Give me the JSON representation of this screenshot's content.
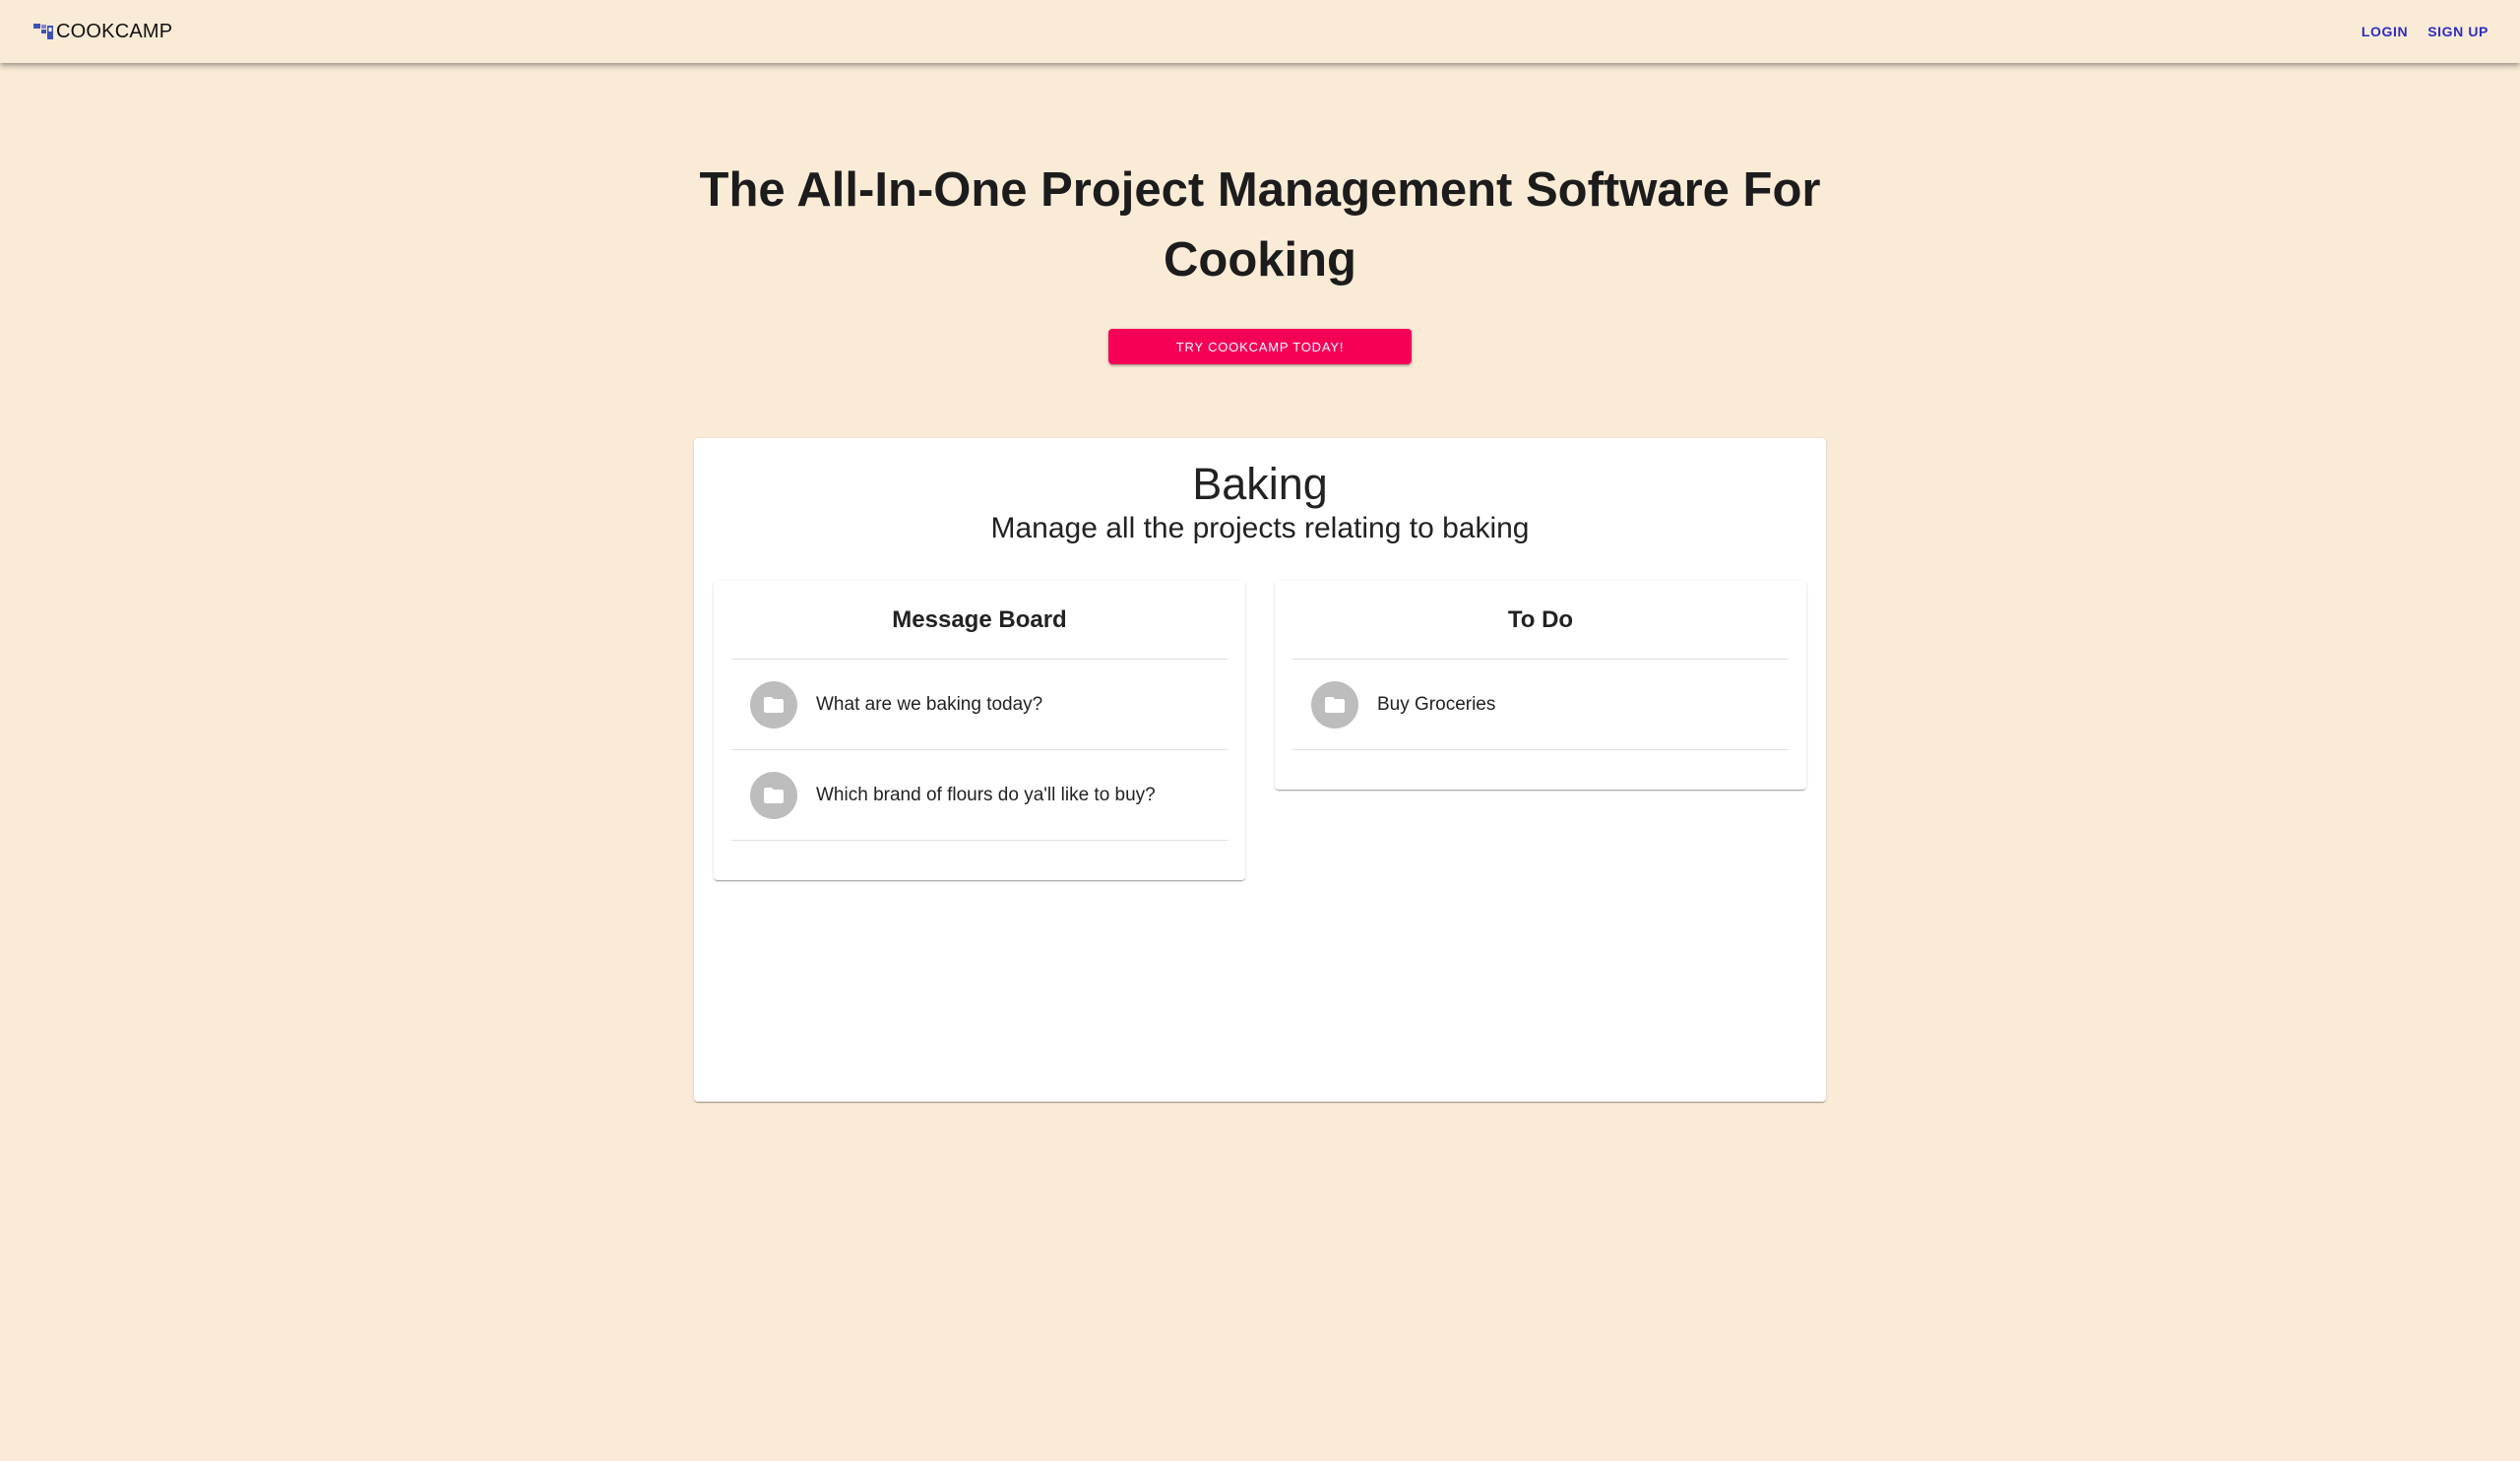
{
  "header": {
    "brand": "COOKCAMP",
    "brand_icon": "logo-grid-icon",
    "nav": {
      "login": "LOGIN",
      "signup": "SIGN UP"
    }
  },
  "hero": {
    "title": "The All-In-One Project Management Software For Cooking",
    "cta": "TRY COOKCAMP TODAY!"
  },
  "project": {
    "title": "Baking",
    "subtitle": "Manage all the projects relating to baking",
    "message_board": {
      "title": "Message Board",
      "items": [
        {
          "icon": "folder-icon",
          "label": "What are we baking today?"
        },
        {
          "icon": "folder-icon",
          "label": "Which brand of flours do ya'll like to buy?"
        }
      ]
    },
    "todo": {
      "title": "To Do",
      "items": [
        {
          "icon": "folder-icon",
          "label": "Buy Groceries"
        }
      ]
    }
  },
  "colors": {
    "background": "#faebd7",
    "accent": "#f50057",
    "nav_link": "#2d2dc4",
    "avatar": "#bdbdbd"
  }
}
